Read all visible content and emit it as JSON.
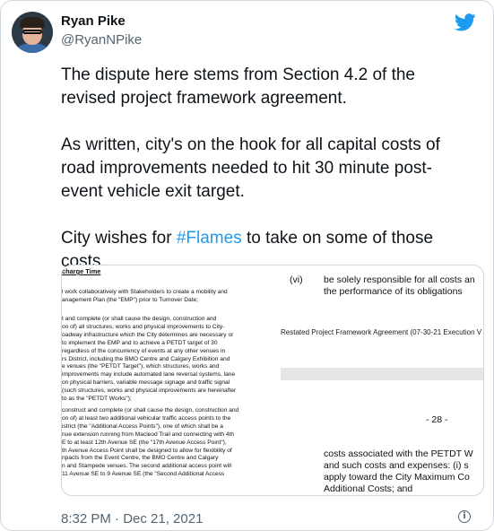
{
  "author": {
    "name": "Ryan Pike",
    "handle": "@RyanNPike"
  },
  "tweet": {
    "paragraphs": [
      "The dispute here stems from Section 4.2 of the revised project framework agreement.",
      "As written, city's on the hook for all capital costs of road improvements needed to hit 30 minute post-event vehicle exit target."
    ],
    "last_before": "City wishes for ",
    "hashtag": "#Flames",
    "last_after": " to take on some of those costs."
  },
  "media": {
    "left_header": "charge Time",
    "left_blocks": [
      [
        "l work collaboratively with Stakeholders to create a mobility and",
        "anagement Plan (the \"EMP\") prior to Turnover Date;"
      ],
      [
        "t and complete (or shall cause the design, construction and",
        "on of) all structures, works and physical improvements to City-",
        "oadway infrastructure which the City determines are necessary or",
        "to implement the EMP and to achieve a PETDT target of 30",
        "regardless of the concurrency of events at any other venues in",
        "rs District, including the BMO Centre and Calgary Exhibition and",
        "e venues (the \"PETDT Target\"), which structures, works and",
        "improvements may include automated lane reversal systems, lane",
        "on physical barriers, variable message signage and traffic signal",
        "(such structures, works and physical improvements are hereinafter",
        "to as the \"PETDT Works\");"
      ],
      [
        "construct and complete (or shall cause the design, construction and",
        "on of) at least two additional vehicular traffic access points to the",
        "istrict (the \"Additional Access Points\"), one of which shall be a",
        "nue extension running from Macleod Trail and connecting with 4th",
        "E to at least 12th Avenue SE (the \"17th Avenue Access Point\"),",
        "th Avenue Access Point shall be designed to allow for flexibility of",
        "npacts from the Event Centre, the BMO Centre and Calgary",
        "n and Stampede venues. The second additional access point will",
        "11 Avenue SE to 9 Avenue SE (the \"Second Additional Access"
      ]
    ],
    "right_vi": "(vi)",
    "right_vi_lines": [
      "be solely responsible for all costs an",
      "the performance of its obligations"
    ],
    "right_footer": "Restated Project Framework Agreement (07-30-21 Execution V",
    "right_page_number": "- 28 -",
    "right_bottom_lines": [
      "costs associated with the PETDT W",
      "and such costs and expenses: (i) s",
      "apply toward the City Maximum Co",
      "Additional Costs; and"
    ]
  },
  "timestamp": "8:32 PM · Dec 21, 2021",
  "colors": {
    "link": "#1d9bf0",
    "muted": "#536471",
    "border": "#cfd9de"
  },
  "icons": {
    "brand": "bird-icon",
    "info": "info-icon"
  }
}
